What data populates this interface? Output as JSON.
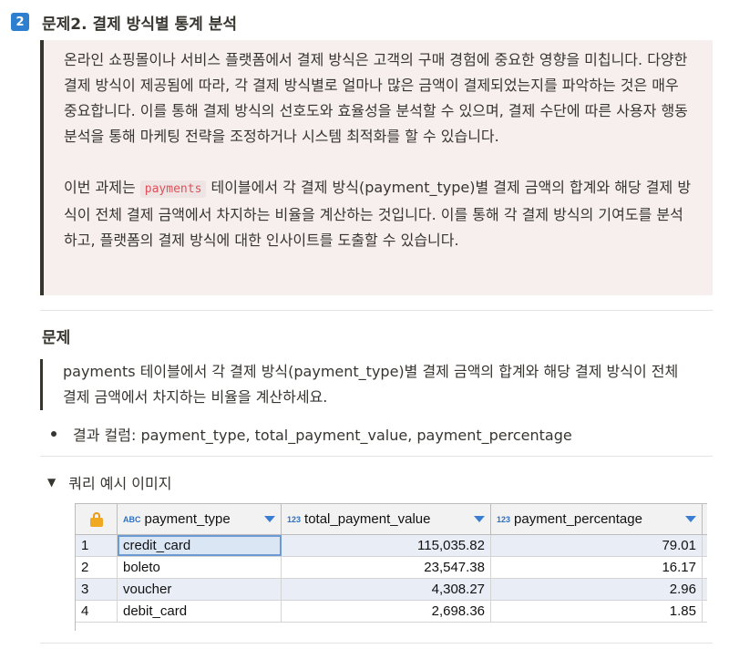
{
  "header": {
    "badge": "2",
    "title": "문제2. 결제 방식별 통계 분석"
  },
  "intro": {
    "paragraph1": "온라인 쇼핑몰이나 서비스 플랫폼에서 결제 방식은 고객의 구매 경험에 중요한 영향을 미칩니다. 다양한 결제 방식이 제공됨에 따라, 각 결제 방식별로 얼마나 많은 금액이 결제되었는지를 파악하는 것은 매우 중요합니다. 이를 통해 결제 방식의 선호도와 효율성을 분석할 수 있으며, 결제 수단에 따른 사용자 행동 분석을 통해 마케팅 전략을 조정하거나 시스템 최적화를 할 수 있습니다.",
    "paragraph2_before": "이번 과제는 ",
    "paragraph2_code": "payments",
    "paragraph2_after": " 테이블에서 각 결제 방식(payment_type)별 결제 금액의 합계와 해당 결제 방식이 전체 결제 금액에서 차지하는 비율을 계산하는 것입니다. 이를 통해 각 결제 방식의 기여도를 분석하고, 플랫폼의 결제 방식에 대한 인사이트를 도출할 수 있습니다."
  },
  "problem": {
    "heading": "문제",
    "quote": "payments 테이블에서 각 결제 방식(payment_type)별 결제 금액의 합계와 해당 결제 방식이 전체 결제 금액에서 차지하는 비율을 계산하세요.",
    "bullet": "결과 컬럼: payment_type, total_payment_value, payment_percentage"
  },
  "toggle": {
    "label": "쿼리 예시 이미지"
  },
  "grid": {
    "columns": [
      {
        "type_tag": "ABC",
        "name": "payment_type"
      },
      {
        "type_tag": "123",
        "name": "total_payment_value"
      },
      {
        "type_tag": "123",
        "name": "payment_percentage"
      }
    ],
    "rows": [
      {
        "num": "1",
        "payment_type": "credit_card",
        "total_payment_value": "115,035.82",
        "payment_percentage": "79.01"
      },
      {
        "num": "2",
        "payment_type": "boleto",
        "total_payment_value": "23,547.38",
        "payment_percentage": "16.17"
      },
      {
        "num": "3",
        "payment_type": "voucher",
        "total_payment_value": "4,308.27",
        "payment_percentage": "2.96"
      },
      {
        "num": "4",
        "payment_type": "debit_card",
        "total_payment_value": "2,698.36",
        "payment_percentage": "1.85"
      }
    ]
  },
  "colors": {
    "badge": "#2f7fd1",
    "callout_bg": "#f7efee",
    "code_text": "#e0505a",
    "row_alt": "#e9eef6",
    "sort_arrow": "#3b7dd0"
  }
}
